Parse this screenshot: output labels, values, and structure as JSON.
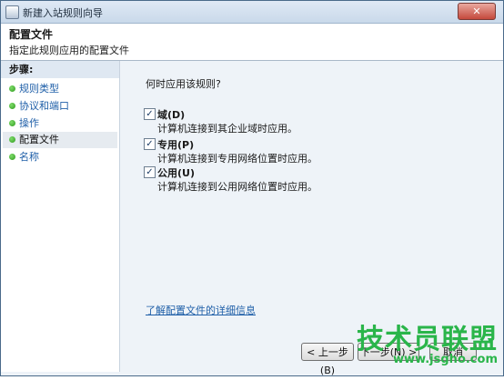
{
  "window": {
    "title": "新建入站规则向导",
    "close_label": "✕"
  },
  "header": {
    "title": "配置文件",
    "subtitle": "指定此规则应用的配置文件"
  },
  "sidebar": {
    "steps_label": "步骤:",
    "items": [
      {
        "label": "规则类型"
      },
      {
        "label": "协议和端口"
      },
      {
        "label": "操作"
      },
      {
        "label": "配置文件"
      },
      {
        "label": "名称"
      }
    ]
  },
  "content": {
    "question": "何时应用该规则?",
    "options": [
      {
        "label": "域(D)",
        "desc": "计算机连接到其企业域时应用。",
        "checked": true
      },
      {
        "label": "专用(P)",
        "desc": "计算机连接到专用网络位置时应用。",
        "checked": true
      },
      {
        "label": "公用(U)",
        "desc": "计算机连接到公用网络位置时应用。",
        "checked": true
      }
    ],
    "info_link": "了解配置文件的详细信息"
  },
  "buttons": {
    "back": "< 上一步(B)",
    "next": "下一步(N) >",
    "cancel": "取消"
  },
  "watermark": {
    "main": "技术员联盟",
    "url": "www.jsgho.com"
  }
}
